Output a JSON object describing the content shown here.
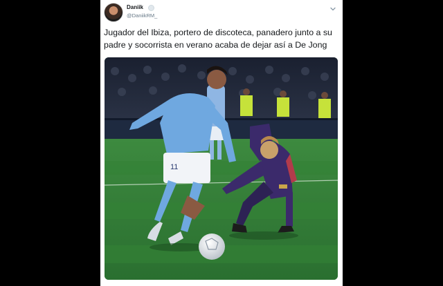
{
  "tweet": {
    "display_name": "Daniik",
    "handle": "@DaniikRM_",
    "text": "Jugador del Ibiza, portero de discoteca, panadero junto a su padre y socorrista en verano acaba de dejar así a De Jong",
    "jersey_number": "11"
  },
  "icons": {
    "options": "chevron-down-icon",
    "verified": "verified-icon"
  },
  "colors": {
    "card_background": "#ffffff",
    "page_background": "#000000",
    "text_primary": "#14171a",
    "text_secondary": "#657786",
    "ibiza_kit": "#6fa8e0",
    "barca_kit": "#3b2a6b",
    "pitch": "#2f7a34"
  }
}
